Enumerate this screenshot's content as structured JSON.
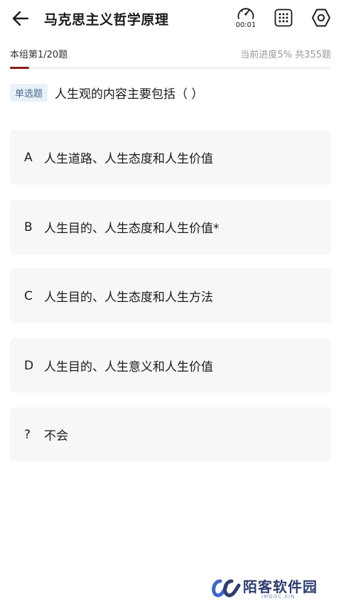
{
  "header": {
    "title": "马克思主义哲学原理",
    "timer": "00:01",
    "icons": {
      "back": "arrow-left-icon",
      "timer": "stopwatch-icon",
      "grid": "answer-card-icon",
      "settings": "settings-icon"
    }
  },
  "progress": {
    "group_label": "本组第1/20题",
    "progress_label": "当前进度5%  共355题",
    "fraction": 0.05,
    "accent_color": "#8b1a1a"
  },
  "question": {
    "type": "单选题",
    "text": "人生观的内容主要包括（  ）"
  },
  "options": [
    {
      "letter": "A",
      "text": "人生道路、人生态度和人生价值"
    },
    {
      "letter": "B",
      "text": "人生目的、人生态度和人生价值*"
    },
    {
      "letter": "C",
      "text": "人生目的、人生态度和人生方法"
    },
    {
      "letter": "D",
      "text": "人生目的、人生意义和人生价值"
    },
    {
      "letter": "?",
      "text": "不会"
    }
  ],
  "watermark": {
    "text": "陌客软件园",
    "sub": "IMOOC.XIN"
  }
}
